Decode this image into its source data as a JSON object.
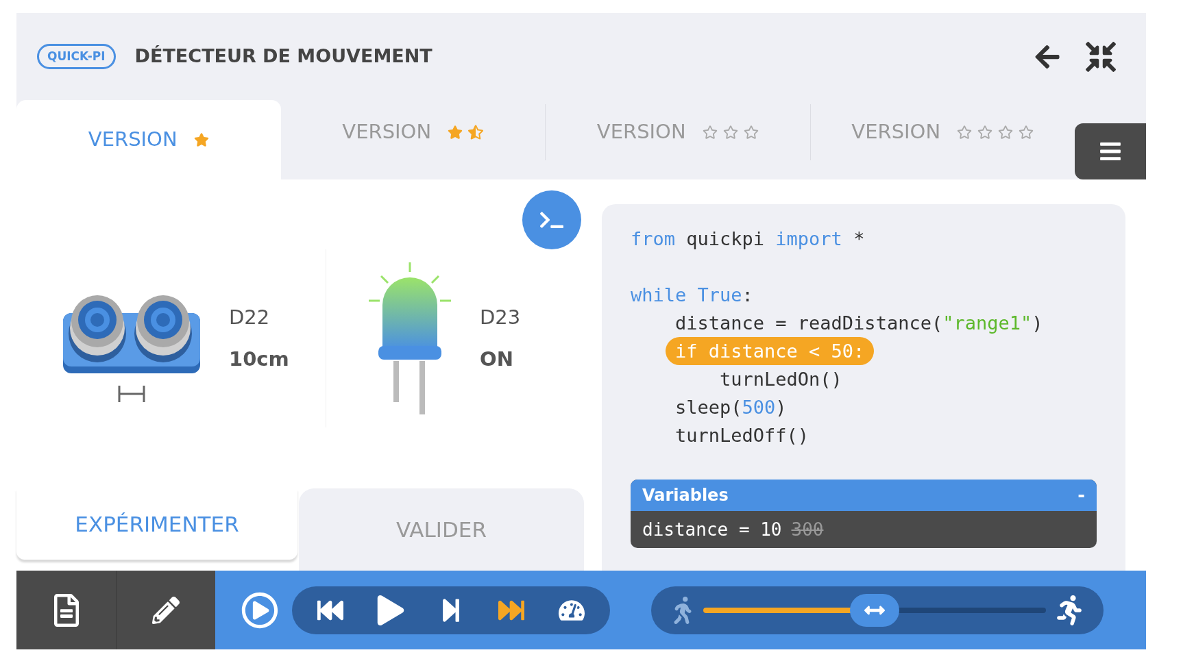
{
  "header": {
    "logo": "QUICK-PI",
    "title": "DÉTECTEUR DE MOUVEMENT"
  },
  "version_tabs": [
    {
      "label": "VERSION",
      "selected": true,
      "star_icons": [
        {
          "kind": "full"
        }
      ]
    },
    {
      "label": "VERSION",
      "selected": false,
      "star_icons": [
        {
          "kind": "full"
        },
        {
          "kind": "half"
        }
      ]
    },
    {
      "label": "VERSION",
      "selected": false,
      "star_icons": [
        {
          "kind": "empty"
        },
        {
          "kind": "empty"
        },
        {
          "kind": "empty"
        }
      ]
    },
    {
      "label": "VERSION",
      "selected": false,
      "star_icons": [
        {
          "kind": "empty"
        },
        {
          "kind": "empty"
        },
        {
          "kind": "empty"
        },
        {
          "kind": "empty"
        }
      ]
    }
  ],
  "sensors": [
    {
      "kind": "distance",
      "port": "D22",
      "value": "10cm"
    },
    {
      "kind": "led",
      "port": "D23",
      "value": "ON",
      "on": true
    }
  ],
  "mode_tabs": [
    {
      "label": "EXPÉRIMENTER",
      "selected": true
    },
    {
      "label": "VALIDER",
      "selected": false
    }
  ],
  "code": {
    "lines": [
      {
        "kind": "code",
        "highlighted": false,
        "tokens": [
          {
            "kind": "keyword",
            "text": "from"
          },
          {
            "kind": "plain",
            "text": " quickpi "
          },
          {
            "kind": "keyword",
            "text": "import"
          },
          {
            "kind": "plain",
            "text": " *"
          }
        ]
      },
      {
        "kind": "blank"
      },
      {
        "kind": "code",
        "highlighted": false,
        "tokens": [
          {
            "kind": "keyword",
            "text": "while"
          },
          {
            "kind": "keyword",
            "text": " True"
          },
          {
            "kind": "plain",
            "text": ":"
          }
        ]
      },
      {
        "kind": "code",
        "highlighted": false,
        "tokens": [
          {
            "kind": "plain",
            "text": "    distance = readDistance("
          },
          {
            "kind": "string",
            "text": "\"range1\""
          },
          {
            "kind": "plain",
            "text": ")"
          }
        ]
      },
      {
        "kind": "code",
        "highlighted": true,
        "tokens": [
          {
            "kind": "plain",
            "text": "    if distance < 50:"
          }
        ]
      },
      {
        "kind": "code",
        "highlighted": false,
        "tokens": [
          {
            "kind": "plain",
            "text": "        turnLedOn()"
          }
        ]
      },
      {
        "kind": "code",
        "highlighted": false,
        "tokens": [
          {
            "kind": "plain",
            "text": "    sleep("
          },
          {
            "kind": "number",
            "text": "500"
          },
          {
            "kind": "plain",
            "text": ")"
          }
        ]
      },
      {
        "kind": "code",
        "highlighted": false,
        "tokens": [
          {
            "kind": "plain",
            "text": "    turnLedOff()"
          }
        ]
      }
    ]
  },
  "variables": {
    "title": "Variables",
    "collapse": "-",
    "items": [
      {
        "text": "distance = 10",
        "previous_value": "300"
      }
    ]
  },
  "controls": [
    {
      "kind": "restart",
      "highlighted": false
    },
    {
      "kind": "play",
      "highlighted": false
    },
    {
      "kind": "step",
      "highlighted": false
    },
    {
      "kind": "fast",
      "highlighted": true
    },
    {
      "kind": "speedometer",
      "highlighted": false
    }
  ],
  "speed": {
    "level": 0.5
  }
}
